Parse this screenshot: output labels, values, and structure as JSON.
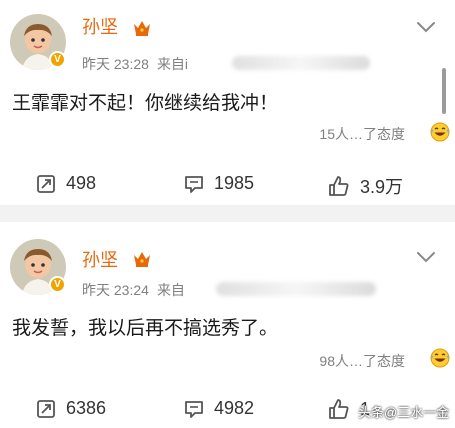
{
  "posts": [
    {
      "username": "孙坚",
      "time": "昨天 23:28",
      "source_prefix": "来自i",
      "content": "王霏霏对不起！你继续给我冲！",
      "attitude": "15人…了态度",
      "repost_count": "498",
      "comment_count": "1985",
      "like_count": "3.9万"
    },
    {
      "username": "孙坚",
      "time": "昨天 23:24",
      "source_prefix": "来自",
      "content": "我发誓，我以后再不搞选秀了。",
      "attitude": "98人…了态度",
      "repost_count": "6386",
      "comment_count": "4982",
      "like_count": "1"
    }
  ],
  "watermark": "头条@三水一金",
  "colors": {
    "username": "#e8680c",
    "badge": "#f0a400",
    "separator": "#f2f2f2"
  },
  "icons": [
    "crown-icon",
    "chevron-down-icon",
    "repost-icon",
    "comment-icon",
    "like-icon",
    "laugh-emoji-icon",
    "verified-badge-icon"
  ]
}
